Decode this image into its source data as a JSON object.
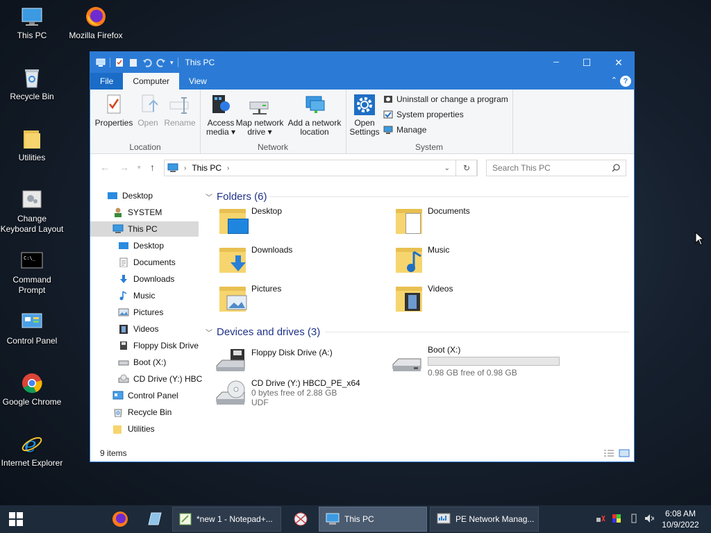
{
  "desktop": {
    "icons": [
      {
        "label": "This PC",
        "icon": "this-pc-icon"
      },
      {
        "label": "Mozilla Firefox",
        "icon": "firefox-icon"
      },
      {
        "label": "Recycle Bin",
        "icon": "recycle-bin-icon"
      },
      {
        "label": "Utilities",
        "icon": "folder-icon"
      },
      {
        "label": "Change Keyboard Layout",
        "icon": "keyboard-layout-icon"
      },
      {
        "label": "Command Prompt",
        "icon": "command-prompt-icon"
      },
      {
        "label": "Control Panel",
        "icon": "control-panel-icon"
      },
      {
        "label": "Google Chrome",
        "icon": "chrome-icon"
      },
      {
        "label": "Internet Explorer",
        "icon": "internet-explorer-icon"
      }
    ]
  },
  "window": {
    "title": "This PC",
    "controls": {
      "minimize": "─",
      "maximize": "☐",
      "close": "✕"
    },
    "tabs": {
      "file": "File",
      "computer": "Computer",
      "view": "View"
    },
    "ribbon": {
      "location": {
        "label": "Location",
        "properties": "Properties",
        "open": "Open",
        "rename": "Rename"
      },
      "network": {
        "label": "Network",
        "access_media_1": "Access",
        "access_media_2": "media ▾",
        "map_drive_1": "Map network",
        "map_drive_2": "drive ▾",
        "add_location_1": "Add a network",
        "add_location_2": "location"
      },
      "system": {
        "label": "System",
        "open_settings_1": "Open",
        "open_settings_2": "Settings",
        "uninstall": "Uninstall or change a program",
        "system_properties": "System properties",
        "manage": "Manage"
      }
    },
    "address": {
      "path": "This PC",
      "search_placeholder": "Search This PC"
    },
    "nav": [
      {
        "label": "Desktop"
      },
      {
        "label": "SYSTEM"
      },
      {
        "label": "This PC"
      },
      {
        "label": "Desktop"
      },
      {
        "label": "Documents"
      },
      {
        "label": "Downloads"
      },
      {
        "label": "Music"
      },
      {
        "label": "Pictures"
      },
      {
        "label": "Videos"
      },
      {
        "label": "Floppy Disk Drive"
      },
      {
        "label": "Boot (X:)"
      },
      {
        "label": "CD Drive (Y:) HBC"
      },
      {
        "label": "Control Panel"
      },
      {
        "label": "Recycle Bin"
      },
      {
        "label": "Utilities"
      }
    ],
    "folders_header": "Folders (6)",
    "folders": [
      {
        "label": "Desktop"
      },
      {
        "label": "Documents"
      },
      {
        "label": "Downloads"
      },
      {
        "label": "Music"
      },
      {
        "label": "Pictures"
      },
      {
        "label": "Videos"
      }
    ],
    "devices_header": "Devices and drives (3)",
    "devices": [
      {
        "label": "Floppy Disk Drive (A:)"
      },
      {
        "label": "Boot (X:)",
        "detail": "0.98 GB free of 0.98 GB",
        "used_fraction": 0.0
      },
      {
        "label": "CD Drive (Y:) HBCD_PE_x64",
        "detail": "0 bytes free of 2.88 GB",
        "fs": "UDF"
      }
    ],
    "status": "9 items"
  },
  "taskbar": {
    "tasks": [
      {
        "label": "*new 1 - Notepad+..."
      },
      {
        "label": "This PC"
      },
      {
        "label": "PE Network Manag..."
      }
    ],
    "time": "6:08 AM",
    "date": "10/9/2022"
  },
  "colors": {
    "accent": "#2b7bd6",
    "header_text": "#1e3287",
    "taskbar": "#1c2a3a"
  }
}
